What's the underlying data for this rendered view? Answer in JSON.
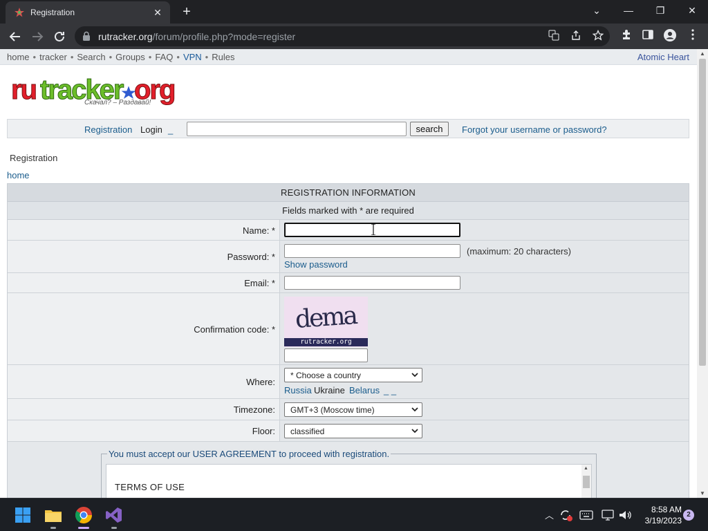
{
  "browser": {
    "tab_title": "Registration",
    "tab_close": "✕",
    "new_tab": "+",
    "url_host": "rutracker.org",
    "url_path": "/forum/profile.php?mode=register",
    "window_controls": {
      "chevron": "⌄",
      "minimize": "—",
      "restore": "❐",
      "close": "✕"
    }
  },
  "topnav": {
    "links": [
      "home",
      "tracker",
      "Search",
      "Groups",
      "FAQ",
      "VPN",
      "Rules"
    ],
    "separator": "•",
    "right_link": "Atomic Heart"
  },
  "logo": {
    "text": "rutracker.org",
    "tagline": "Скачал? – Раздавай!"
  },
  "loginbar": {
    "registration": "Registration",
    "login": "Login",
    "underscore": "_",
    "search_button": "search",
    "forgot": "Forgot your username or password?"
  },
  "page": {
    "title": "Registration",
    "breadcrumb_home": "home"
  },
  "form": {
    "header": "REGISTRATION INFORMATION",
    "required_note": "Fields marked with * are required",
    "name_label": "Name: *",
    "password_label": "Password: *",
    "password_hint": "(maximum: 20 characters)",
    "show_password": "Show password",
    "email_label": "Email: *",
    "captcha_label": "Confirmation code: *",
    "captcha_text": "dema",
    "captcha_site": "rutracker.org",
    "where_label": "Where:",
    "country_select": "* Choose a country",
    "country_russia": "Russia",
    "country_ukraine": "Ukraine",
    "country_belarus": "Belarus",
    "country_extra": "_ _",
    "timezone_label": "Timezone:",
    "timezone_select": "GMT+3 (Moscow time)",
    "floor_label": "Floor:",
    "floor_select": "classified",
    "agreement_legend": "You must accept our USER AGREEMENT to proceed with registration.",
    "terms_heading": "TERMS OF USE"
  },
  "taskbar": {
    "time": "8:58 AM",
    "date": "3/19/2023",
    "notification_count": "2"
  },
  "colors": {
    "browser_dark": "#202124",
    "browser_toolbar": "#35363a",
    "link_blue": "#1a5c8c",
    "form_bg": "#e5e8eb",
    "taskbar": "#1c1f24"
  }
}
